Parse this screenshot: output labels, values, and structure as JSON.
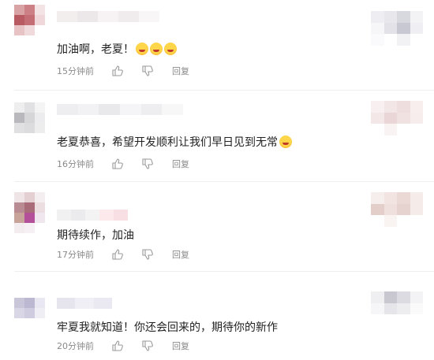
{
  "comments": [
    {
      "text": "加油啊，老夏！",
      "emojis": [
        "laugh-cry-emoji",
        "laugh-cry-emoji",
        "laugh-cry-emoji"
      ],
      "time": "15分钟前",
      "reply_label": "回复"
    },
    {
      "text": "老夏恭喜，希望开发顺利让我们早日见到无常",
      "emojis": [
        "crying-emoji"
      ],
      "time": "16分钟前",
      "reply_label": "回复"
    },
    {
      "text": "期待续作，加油",
      "emojis": [],
      "time": "17分钟前",
      "reply_label": "回复"
    },
    {
      "text": "牢夏我就知道！你还会回来的，期待你的新作",
      "emojis": [],
      "time": "20分钟前",
      "reply_label": "回复"
    }
  ],
  "icons": {
    "like": "thumbs-up-icon",
    "dislike": "thumbs-down-icon"
  }
}
